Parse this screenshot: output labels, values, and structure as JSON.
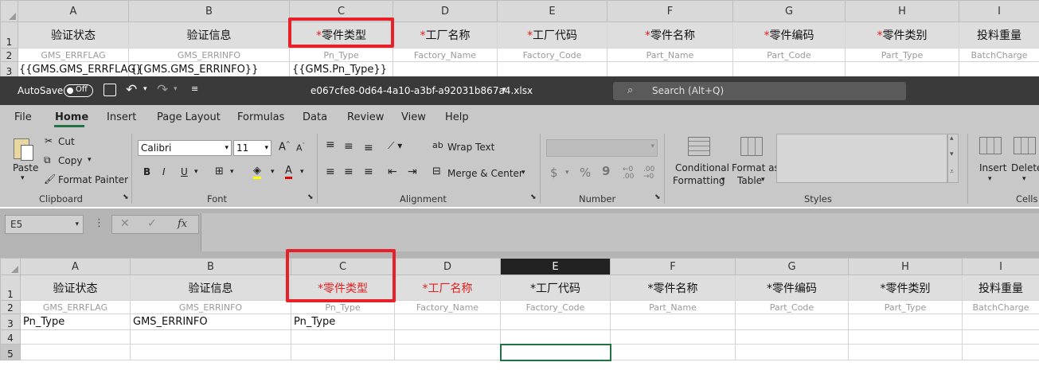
{
  "columns": [
    "A",
    "B",
    "C",
    "D",
    "E",
    "F",
    "G",
    "H",
    "I"
  ],
  "rows": [
    "1",
    "2",
    "3",
    "4",
    "5"
  ],
  "headers": [
    "验证状态",
    "验证信息",
    "*零件类型",
    "*工厂名称",
    "*工厂代码",
    "*零件名称",
    "*零件编码",
    "*零件类别",
    "投料重量"
  ],
  "field_names": [
    "GMS_ERRFLAG",
    "GMS_ERRINFO",
    "Pn_Type",
    "Factory_Name",
    "Factory_Code",
    "Part_Name",
    "Part_Code",
    "Part_Type",
    "BatchCharge"
  ],
  "template_row3": [
    "{{GMS.GMS_ERRFLAG}",
    "{{GMS.GMS_ERRINFO}}",
    "{{GMS.Pn_Type}}"
  ],
  "result_row3": [
    "Pn_Type",
    "GMS_ERRINFO",
    "Pn_Type"
  ],
  "titlebar": {
    "autosave_label": "AutoSave",
    "autosave_state": "Off",
    "filename": "e067cfe8-0d64-4a10-a3bf-a92031b867a4.xlsx",
    "search_placeholder": "Search (Alt+Q)"
  },
  "ribbon_tabs": [
    "File",
    "Home",
    "Insert",
    "Page Layout",
    "Formulas",
    "Data",
    "Review",
    "View",
    "Help"
  ],
  "clipboard": {
    "paste": "Paste",
    "cut": "Cut",
    "copy": "Copy",
    "format_painter": "Format Painter",
    "group": "Clipboard"
  },
  "font": {
    "name": "Calibri",
    "size": "11",
    "group": "Font"
  },
  "alignment": {
    "wrap_text": "Wrap Text",
    "merge_center": "Merge & Center",
    "group": "Alignment"
  },
  "number": {
    "group": "Number"
  },
  "styles": {
    "conditional": "Conditional",
    "formatting": "Formatting",
    "format_as": "Format as",
    "table": "Table",
    "group": "Styles"
  },
  "cells": {
    "insert": "Insert",
    "delete": "Delete",
    "group": "Cells"
  },
  "namebox": "E5",
  "fx": "fx",
  "colors": {
    "accent": "#217346",
    "highlight": "#e8202a",
    "required": "#e02020"
  }
}
